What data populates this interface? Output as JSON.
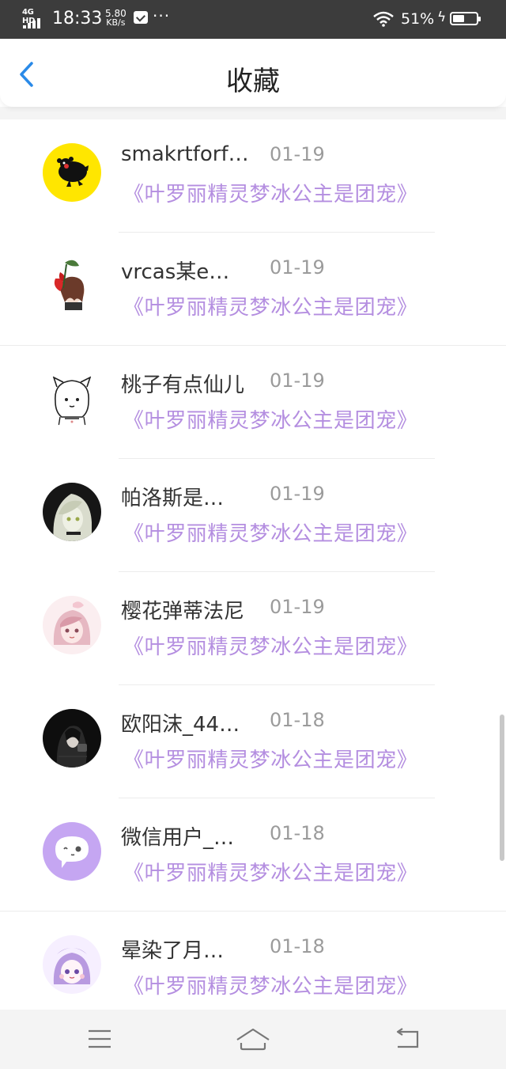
{
  "status_bar": {
    "network": "4G HD",
    "time": "18:33",
    "speed_value": "5.80",
    "speed_unit": "KB/s",
    "dots": "···",
    "battery_percent": "51%",
    "battery_level": 0.51,
    "charging": true
  },
  "header": {
    "title": "收藏",
    "back_icon": "chevron-left-icon",
    "accent_color": "#2a8ae8"
  },
  "colors": {
    "book_title": "#b48ee0",
    "date": "#9b9b9b",
    "username": "#333333"
  },
  "items": [
    {
      "username": "smakrtforf…",
      "date": "01-19",
      "book": "《叶罗丽精灵梦冰公主是团宠》",
      "avatar": "kumamon-avatar"
    },
    {
      "username": "vrcas某e…",
      "date": "01-19",
      "book": "《叶罗丽精灵梦冰公主是团宠》",
      "avatar": "anime-girl-flower-avatar"
    },
    {
      "username": "桃子有点仙儿",
      "date": "01-19",
      "book": "《叶罗丽精灵梦冰公主是团宠》",
      "avatar": "cat-girl-sketch-avatar"
    },
    {
      "username": "帕洛斯是…",
      "date": "01-19",
      "book": "《叶罗丽精灵梦冰公主是团宠》",
      "avatar": "dark-anime-girl-avatar"
    },
    {
      "username": "樱花弹蒂法尼",
      "date": "01-19",
      "book": "《叶罗丽精灵梦冰公主是团宠》",
      "avatar": "pink-anime-girl-avatar"
    },
    {
      "username": "欧阳沫_44…",
      "date": "01-18",
      "book": "《叶罗丽精灵梦冰公主是团宠》",
      "avatar": "dark-photo-avatar"
    },
    {
      "username": "微信用户_…",
      "date": "01-18",
      "book": "《叶罗丽精灵梦冰公主是团宠》",
      "avatar": "default-chat-avatar"
    },
    {
      "username": "晕染了月…",
      "date": "01-18",
      "book": "《叶罗丽精灵梦冰公主是团宠》",
      "avatar": "purple-anime-girl-avatar"
    }
  ],
  "bottom_nav": {
    "menu_icon": "menu-icon",
    "home_icon": "home-icon",
    "back_icon": "back-arrow-icon"
  }
}
